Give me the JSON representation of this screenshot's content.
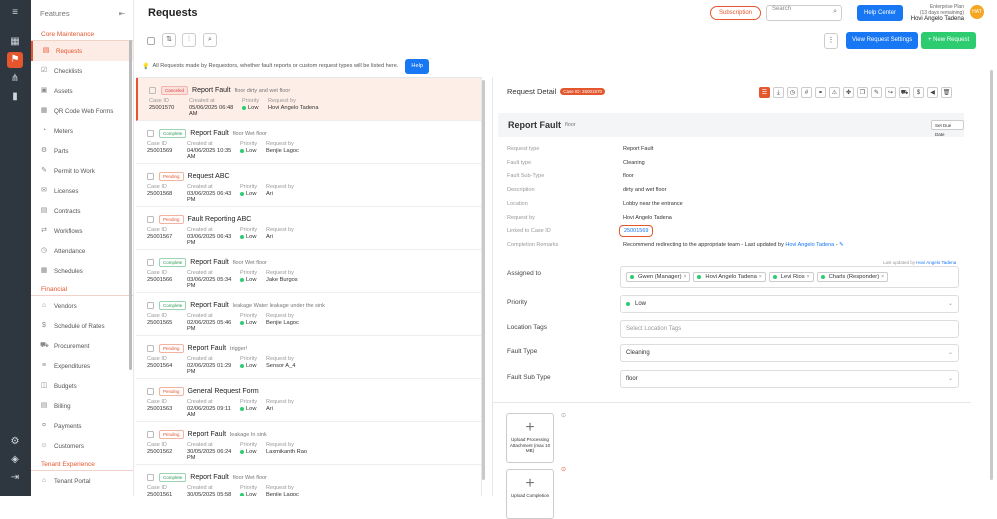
{
  "rail": {
    "icons": [
      "hamburger-icon",
      "dashboard-icon",
      "requests-icon",
      "hierarchy-icon",
      "analytics-icon",
      "settings-icon",
      "package-icon",
      "logout-icon"
    ]
  },
  "nav": {
    "header": "Features",
    "sections": [
      {
        "title": "Core Maintenance",
        "items": [
          "Requests",
          "Checklists",
          "Assets",
          "QR Code Web Forms",
          "Meters",
          "Parts",
          "Permit to Work",
          "Licenses",
          "Contracts",
          "Workflows",
          "Attendance",
          "Schedules"
        ]
      },
      {
        "title": "Financial",
        "items": [
          "Vendors",
          "Schedule of Rates",
          "Procurement",
          "Expenditures",
          "Budgets",
          "Billing",
          "Payments",
          "Customers"
        ]
      },
      {
        "title": "Tenant Experience",
        "items": [
          "Tenant Portal"
        ]
      }
    ]
  },
  "top": {
    "title": "Requests",
    "subscription": "Subscription",
    "search_placeholder": "Search",
    "help_center": "Help Center",
    "plan": "Enterprise Plan",
    "days_left": "(13 days remaining)",
    "user_name": "Hovi Angelo Tadena",
    "avatar": "HAT"
  },
  "toolbar": {
    "view_settings": "View Request Settings",
    "new_request": "New Request",
    "kebab": "⋮"
  },
  "notice": {
    "text": "All Requests made by Requestors, whether fault reports or custom request types will be listed here.",
    "help": "Help"
  },
  "labels": {
    "case_id": "Case ID",
    "created_at": "Created at",
    "priority": "Priority",
    "request_by": "Request by"
  },
  "requests": [
    {
      "status": "Canceled",
      "status_class": "canceled",
      "title": "Report Fault",
      "desc": "floor dirty and wet floor",
      "case_id": "25001570",
      "created": "05/06/2025 06:48 AM",
      "priority": "Low",
      "by": "Hovi Angelo Tadena"
    },
    {
      "status": "Complete",
      "status_class": "complete",
      "title": "Report Fault",
      "desc": "floor Wet floor",
      "case_id": "25001569",
      "created": "04/06/2025 10:35 AM",
      "priority": "Low",
      "by": "Benjie Lagoc"
    },
    {
      "status": "Pending",
      "status_class": "pending",
      "title": "Request ABC",
      "desc": "",
      "case_id": "25001568",
      "created": "03/06/2025 06:43 PM",
      "priority": "Low",
      "by": "Ari"
    },
    {
      "status": "Pending",
      "status_class": "pending",
      "title": "Fault Reporting ABC",
      "desc": "",
      "case_id": "25001567",
      "created": "03/06/2025 06:43 PM",
      "priority": "Low",
      "by": "Ari"
    },
    {
      "status": "Complete",
      "status_class": "complete",
      "title": "Report Fault",
      "desc": "floor Wet floor",
      "case_id": "25001566",
      "created": "03/06/2025 05:34 PM",
      "priority": "Low",
      "by": "Jake Burgos"
    },
    {
      "status": "Complete",
      "status_class": "complete",
      "title": "Report Fault",
      "desc": "leakage Water leakage under the sink",
      "case_id": "25001565",
      "created": "02/06/2025 05:46 PM",
      "priority": "Low",
      "by": "Benjie Lagoc"
    },
    {
      "status": "Pending",
      "status_class": "pending",
      "title": "Report Fault",
      "desc": "trigger!",
      "case_id": "25001564",
      "created": "02/06/2025 01:29 PM",
      "priority": "Low",
      "by": "Sensor A_4"
    },
    {
      "status": "Pending",
      "status_class": "pending",
      "title": "General Request Form",
      "desc": "",
      "case_id": "25001563",
      "created": "02/06/2025 09:11 AM",
      "priority": "Low",
      "by": "Ari"
    },
    {
      "status": "Pending",
      "status_class": "pending",
      "title": "Report Fault",
      "desc": "leakage In sink",
      "case_id": "25001562",
      "created": "30/05/2025 06:24 PM",
      "priority": "Low",
      "by": "Laxmikanth Rao"
    },
    {
      "status": "Complete",
      "status_class": "complete",
      "title": "Report Fault",
      "desc": "floor Wet floor",
      "case_id": "25001561",
      "created": "30/05/2025 05:58 PM",
      "priority": "Low",
      "by": "Benjie Lagoc"
    }
  ],
  "detail": {
    "header": "Request Detail",
    "case_pill": "Case ID: 25001570",
    "fault_title": "Report Fault",
    "fault_sub": "floor",
    "set_due": "Set Due Date",
    "fields": [
      {
        "k": "Request type",
        "v": "Report Fault"
      },
      {
        "k": "Fault type",
        "v": "Cleaning"
      },
      {
        "k": "Fault Sub-Type",
        "v": "floor"
      },
      {
        "k": "Description",
        "v": "dirty and wet floor"
      },
      {
        "k": "Location",
        "v": "Lobby near the entrance"
      },
      {
        "k": "Request by",
        "v": "Hovi Angelo Tadena"
      },
      {
        "k": "Linked to Case ID",
        "v": "25001569"
      },
      {
        "k": "Completion Remarks",
        "v": "Recommend redirecting to the appropriate team - Last updated by"
      }
    ],
    "remarks_by": "Hovi Angelo Tadena",
    "remarks_sep": "-",
    "last_updated_by": "Last updated by",
    "last_updated_name": "Hovi Angelo Tadena",
    "assigned_label": "Assigned to",
    "assignees": [
      "Gwen (Manager)",
      "Hovi Angelo Tadena",
      "Levi Rios",
      "Charls (Responder)"
    ],
    "priority_label": "Priority",
    "priority_value": "Low",
    "location_tags_label": "Location Tags",
    "location_tags_placeholder": "Select Location Tags",
    "fault_type_label": "Fault Type",
    "fault_type_value": "Cleaning",
    "fault_subtype_label": "Fault Sub Type",
    "fault_subtype_value": "floor",
    "upload1": "Upload Processing Attachment (max 10 MB)",
    "upload2": "Upload Completion"
  }
}
